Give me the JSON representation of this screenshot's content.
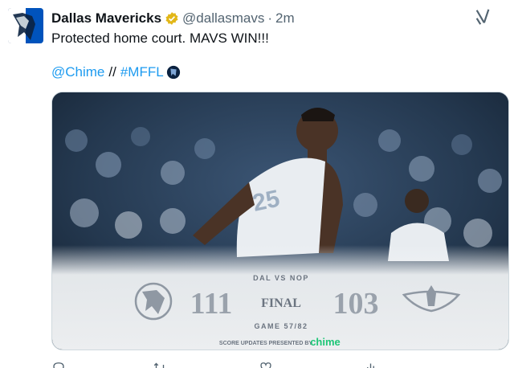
{
  "account": {
    "display_name": "Dallas Mavericks",
    "handle": "@dallasmavs",
    "separator": "·",
    "time": "2m"
  },
  "tweet": {
    "text": "Protected home court. MAVS WIN!!!",
    "mention": "@Chime",
    "separator": "//",
    "hashtag": "#MFFL"
  },
  "scorecard": {
    "matchup": "DAL VS NOP",
    "home_score": "111",
    "status": "FINAL",
    "away_score": "103",
    "game": "GAME 57/82",
    "presented_by": "SCORE UPDATES PRESENTED BY",
    "sponsor": "chime",
    "jersey_number": "25"
  },
  "icons": {
    "verified": "verified-badge-icon",
    "grok": "grok-icon",
    "reply": "reply-icon",
    "retweet": "retweet-icon",
    "like": "like-icon",
    "views": "views-icon"
  },
  "colors": {
    "link": "#1d9bf0",
    "verified": "#e2b719",
    "mavs_blue": "#0053bc",
    "chime_green": "#1ec677"
  }
}
